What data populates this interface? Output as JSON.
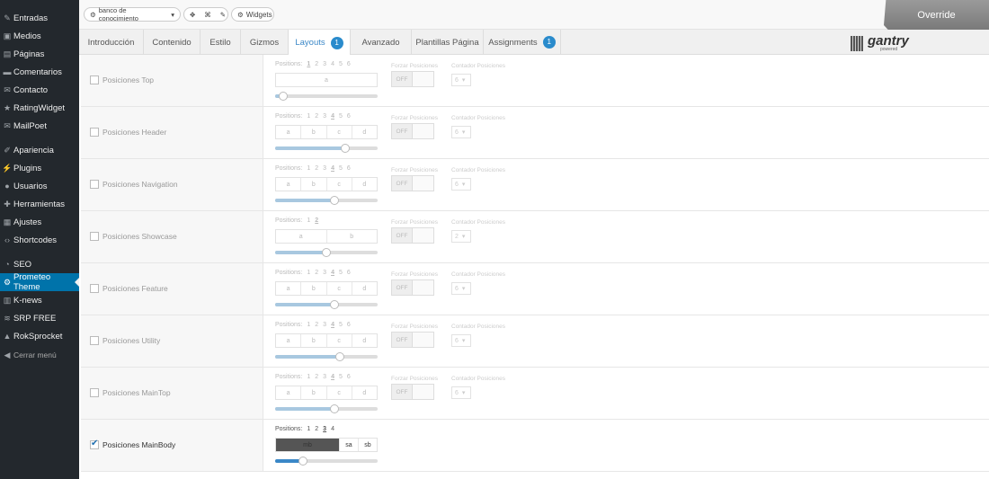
{
  "sidebar": {
    "items": [
      {
        "label": "Entradas",
        "icon": "pin-icon",
        "glyph": "✎"
      },
      {
        "label": "Medios",
        "icon": "media-icon",
        "glyph": "▣"
      },
      {
        "label": "Páginas",
        "icon": "pages-icon",
        "glyph": "▤"
      },
      {
        "label": "Comentarios",
        "icon": "comments-icon",
        "glyph": "▬"
      },
      {
        "label": "Contacto",
        "icon": "mail-icon",
        "glyph": "✉"
      },
      {
        "label": "RatingWidget",
        "icon": "rating-icon",
        "glyph": "★"
      },
      {
        "label": "MailPoet",
        "icon": "mailpoet-icon",
        "glyph": "✉"
      },
      {
        "label": "Apariencia",
        "icon": "brush-icon",
        "glyph": "✐"
      },
      {
        "label": "Plugins",
        "icon": "plug-icon",
        "glyph": "⚡"
      },
      {
        "label": "Usuarios",
        "icon": "user-icon",
        "glyph": "●"
      },
      {
        "label": "Herramientas",
        "icon": "wrench-icon",
        "glyph": "✚"
      },
      {
        "label": "Ajustes",
        "icon": "settings-icon",
        "glyph": "▦"
      },
      {
        "label": "Shortcodes",
        "icon": "code-icon",
        "glyph": "‹›"
      },
      {
        "label": "SEO",
        "icon": "seo-icon",
        "glyph": "◔"
      },
      {
        "label": "Prometeo Theme",
        "icon": "gear-icon",
        "glyph": "⚙"
      },
      {
        "label": "K-news",
        "icon": "news-icon",
        "glyph": "▥"
      },
      {
        "label": "SRP FREE",
        "icon": "srp-icon",
        "glyph": "≋"
      },
      {
        "label": "RokSprocket",
        "icon": "rok-icon",
        "glyph": "▲"
      },
      {
        "label": "Cerrar menú",
        "icon": "collapse-icon",
        "glyph": "◀"
      }
    ]
  },
  "toolbar": {
    "context_label": "banco de conocimiento",
    "widgets_label": "Widgets",
    "override_label": "Override"
  },
  "tabs": [
    {
      "label": "Introducción"
    },
    {
      "label": "Contenido"
    },
    {
      "label": "Estilo"
    },
    {
      "label": "Gizmos"
    },
    {
      "label": "Layouts",
      "badge": "1"
    },
    {
      "label": "Avanzado"
    },
    {
      "label": "Plantillas Página"
    },
    {
      "label": "Assignments",
      "badge": "1"
    }
  ],
  "logo": {
    "name": "gantry",
    "sub": "powered"
  },
  "labels": {
    "positions": "Positions:",
    "forzar": "Forzar Posiciones",
    "contador": "Contador Posiciones",
    "off": "OFF"
  },
  "rows": [
    {
      "name": "Posiciones Top",
      "checked": false,
      "nums": [
        "1",
        "2",
        "3",
        "4",
        "5",
        "6"
      ],
      "selected": "1",
      "cells": [
        "a"
      ],
      "slider": 0.08,
      "count": "6"
    },
    {
      "name": "Posiciones Header",
      "checked": false,
      "nums": [
        "1",
        "2",
        "3",
        "4",
        "5",
        "6"
      ],
      "selected": "4",
      "cells": [
        "a",
        "b",
        "c",
        "d"
      ],
      "slider": 0.68,
      "count": "6"
    },
    {
      "name": "Posiciones Navigation",
      "checked": false,
      "nums": [
        "1",
        "2",
        "3",
        "4",
        "5",
        "6"
      ],
      "selected": "4",
      "cells": [
        "a",
        "b",
        "c",
        "d"
      ],
      "slider": 0.58,
      "count": "6"
    },
    {
      "name": "Posiciones Showcase",
      "checked": false,
      "nums": [
        "1",
        "2"
      ],
      "selected": "2",
      "cells": [
        "a",
        "b"
      ],
      "slider": 0.5,
      "count": "2"
    },
    {
      "name": "Posiciones Feature",
      "checked": false,
      "nums": [
        "1",
        "2",
        "3",
        "4",
        "5",
        "6"
      ],
      "selected": "4",
      "cells": [
        "a",
        "b",
        "c",
        "d"
      ],
      "slider": 0.58,
      "count": "6"
    },
    {
      "name": "Posiciones Utility",
      "checked": false,
      "nums": [
        "1",
        "2",
        "3",
        "4",
        "5",
        "6"
      ],
      "selected": "4",
      "cells": [
        "a",
        "b",
        "c",
        "d"
      ],
      "slider": 0.63,
      "count": "6"
    },
    {
      "name": "Posiciones MainTop",
      "checked": false,
      "nums": [
        "1",
        "2",
        "3",
        "4",
        "5",
        "6"
      ],
      "selected": "4",
      "cells": [
        "a",
        "b",
        "c",
        "d"
      ],
      "slider": 0.58,
      "count": "6"
    },
    {
      "name": "Posiciones MainBody",
      "checked": true,
      "nums": [
        "1",
        "2",
        "3",
        "4"
      ],
      "selected": "3",
      "cells": [
        "mb",
        "sa",
        "sb"
      ],
      "slider": 0.27,
      "count": ""
    }
  ],
  "colors": {
    "accent": "#0073aa",
    "sidebar_bg": "#23282d",
    "badge": "#2a8bcc"
  }
}
